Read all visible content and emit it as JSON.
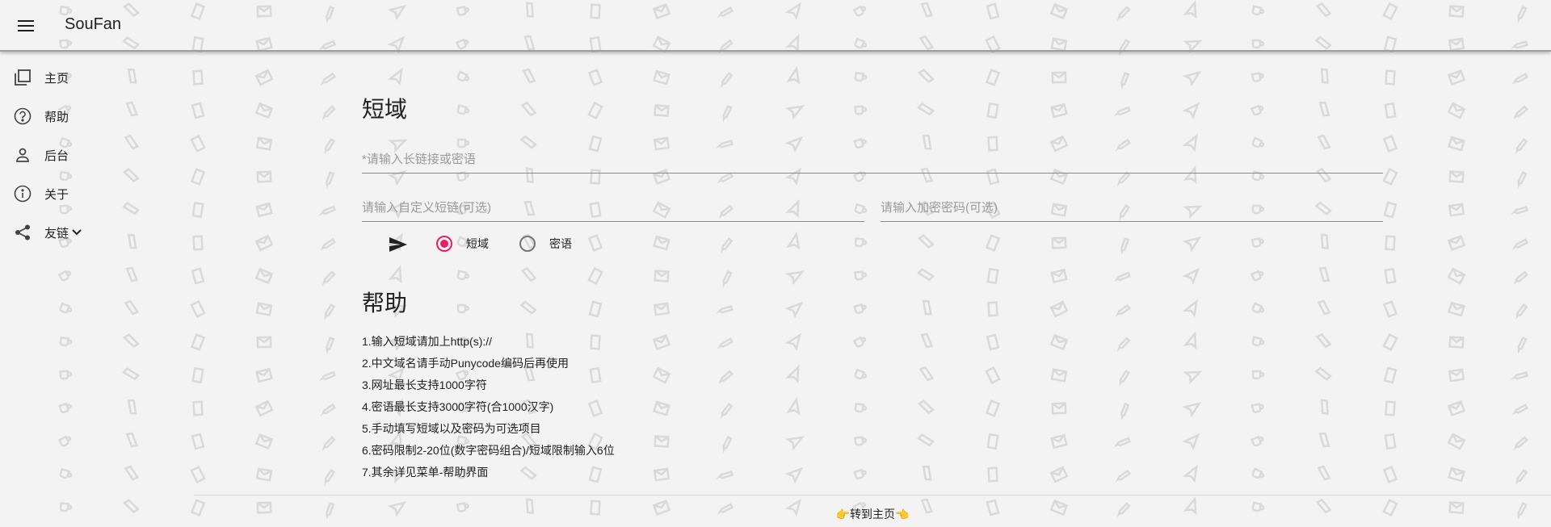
{
  "app": {
    "title": "SouFan"
  },
  "sidebar": {
    "items": [
      {
        "label": "主页",
        "icon": "library-icon"
      },
      {
        "label": "帮助",
        "icon": "help-circle-icon"
      },
      {
        "label": "后台",
        "icon": "person-icon"
      },
      {
        "label": "关于",
        "icon": "info-icon"
      },
      {
        "label": "友链",
        "icon": "share-icon"
      }
    ]
  },
  "form": {
    "title": "短域",
    "url_placeholder": "*请输入长链接或密语",
    "custom_placeholder": "请输入自定义短链(可选)",
    "password_placeholder": "请输入加密密码(可选)",
    "radio_short": "短域",
    "radio_secret": "密语",
    "selected": "短域"
  },
  "help": {
    "title": "帮助",
    "items": [
      "1.输入短域请加上http(s)://",
      "2.中文域名请手动Punycode编码后再使用",
      "3.网址最长支持1000字符",
      "4.密语最长支持3000字符(合1000汉字)",
      "5.手动填写短域以及密码为可选项目",
      "6.密码限制2-20位(数字密码组合)/短域限制输入6位",
      "7.其余详见菜单-帮助界面"
    ]
  },
  "footer": {
    "link": "👉转到主页👈"
  },
  "colors": {
    "accent": "#e91e63",
    "background": "#f3f3f3",
    "text": "#212121"
  }
}
